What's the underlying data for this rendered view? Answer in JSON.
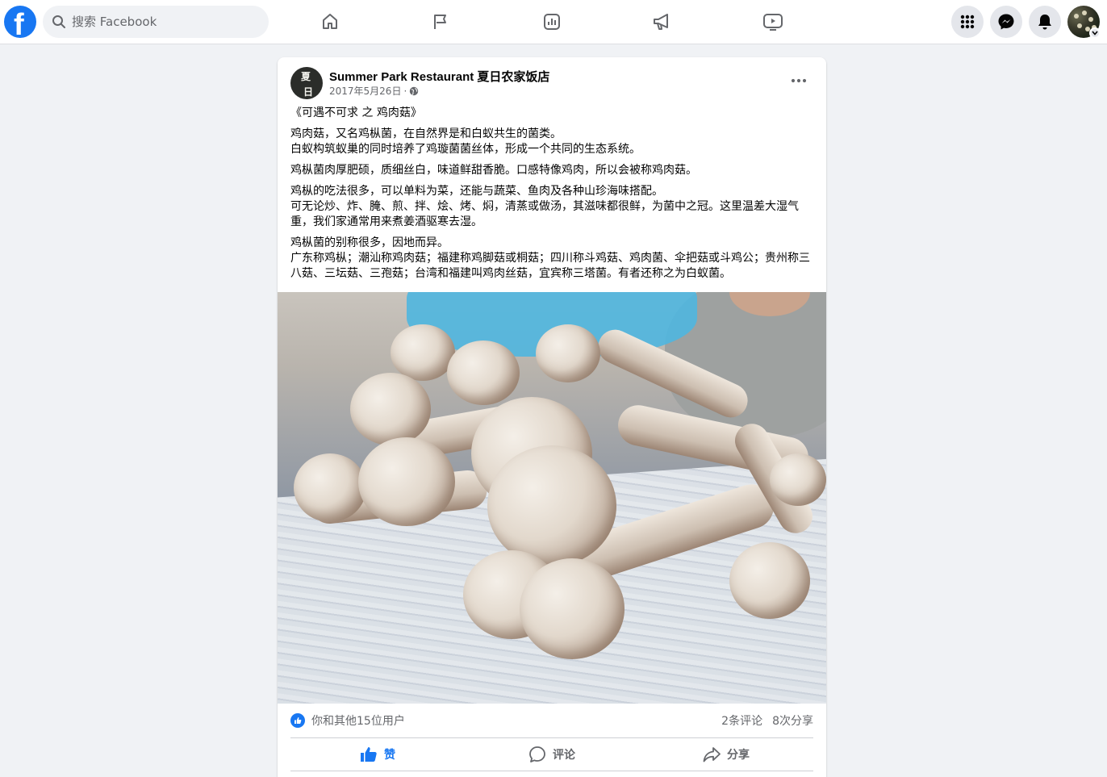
{
  "header": {
    "search": {
      "placeholder": "搜索 Facebook"
    },
    "brand_color": "#1877f2",
    "nav": [
      "home-icon",
      "pages-flag-icon",
      "insights-icon",
      "ads-megaphone-icon",
      "watch-video-icon"
    ],
    "right_buttons": [
      "menu-grid-icon",
      "messenger-icon",
      "notifications-bell-icon",
      "account-avatar"
    ]
  },
  "post": {
    "page_name": "Summer Park Restaurant 夏日农家饭店",
    "avatar_text": [
      "夏",
      "日"
    ],
    "date": "2017年5月26日",
    "dot": "·",
    "privacy_icon": "globe-icon",
    "paragraphs": [
      [
        "《可遇不可求 之 鸡肉菇》"
      ],
      [
        "鸡肉菇，又名鸡枞菌，在自然界是和白蚁共生的菌类。",
        "白蚁构筑蚁巢的同时培养了鸡璇菌菌丝体，形成一个共同的生态系统。"
      ],
      [
        "鸡枞菌肉厚肥硕，质细丝白，味道鲜甜香脆。口感特像鸡肉，所以会被称鸡肉菇。"
      ],
      [
        "鸡枞的吃法很多，可以单料为菜，还能与蔬菜、鱼肉及各种山珍海味搭配。",
        "可无论炒、炸、腌、煎、拌、烩、烤、焖，清蒸或做汤，其滋味都很鲜，为菌中之冠。这里温差大湿气重，我们家通常用来煮姜酒驱寒去湿。"
      ],
      [
        "鸡枞菌的别称很多，因地而异。",
        "广东称鸡枞；潮汕称鸡肉菇；福建称鸡脚菇或桐菇；四川称斗鸡菇、鸡肉菌、伞把菇或斗鸡公；贵州称三八菇、三坛菇、三孢菇；台湾和福建叫鸡肉丝菇，宜宾称三塔菌。有者还称之为白蚁菌。"
      ]
    ],
    "photo_subject": "pile of fresh termite mushrooms on newspaper"
  },
  "footer": {
    "reactions_text": "你和其他15位用户",
    "comments_count": "2条评论",
    "shares_count": "8次分享",
    "actions": {
      "like": "赞",
      "comment": "评论",
      "share": "分享"
    }
  }
}
